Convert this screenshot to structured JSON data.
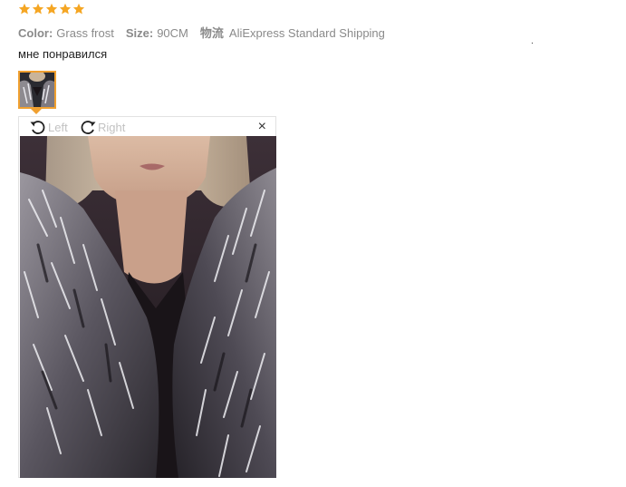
{
  "review": {
    "rating": 5,
    "star_color": "#f5a623",
    "color_label": "Color:",
    "color_value": "Grass frost",
    "size_label": "Size:",
    "size_value": "90CM",
    "shipping_label": "物流",
    "shipping_value": "AliExpress Standard Shipping",
    "comment": "мне понравился"
  },
  "thumbnail": {
    "icon": "photo-thumbnail",
    "border_color": "#f0a030"
  },
  "viewer": {
    "rotate_left_label": "Left",
    "rotate_right_label": "Right",
    "close_label": "×",
    "rotate_left_icon": "rotate-left-icon",
    "rotate_right_icon": "rotate-right-icon"
  }
}
